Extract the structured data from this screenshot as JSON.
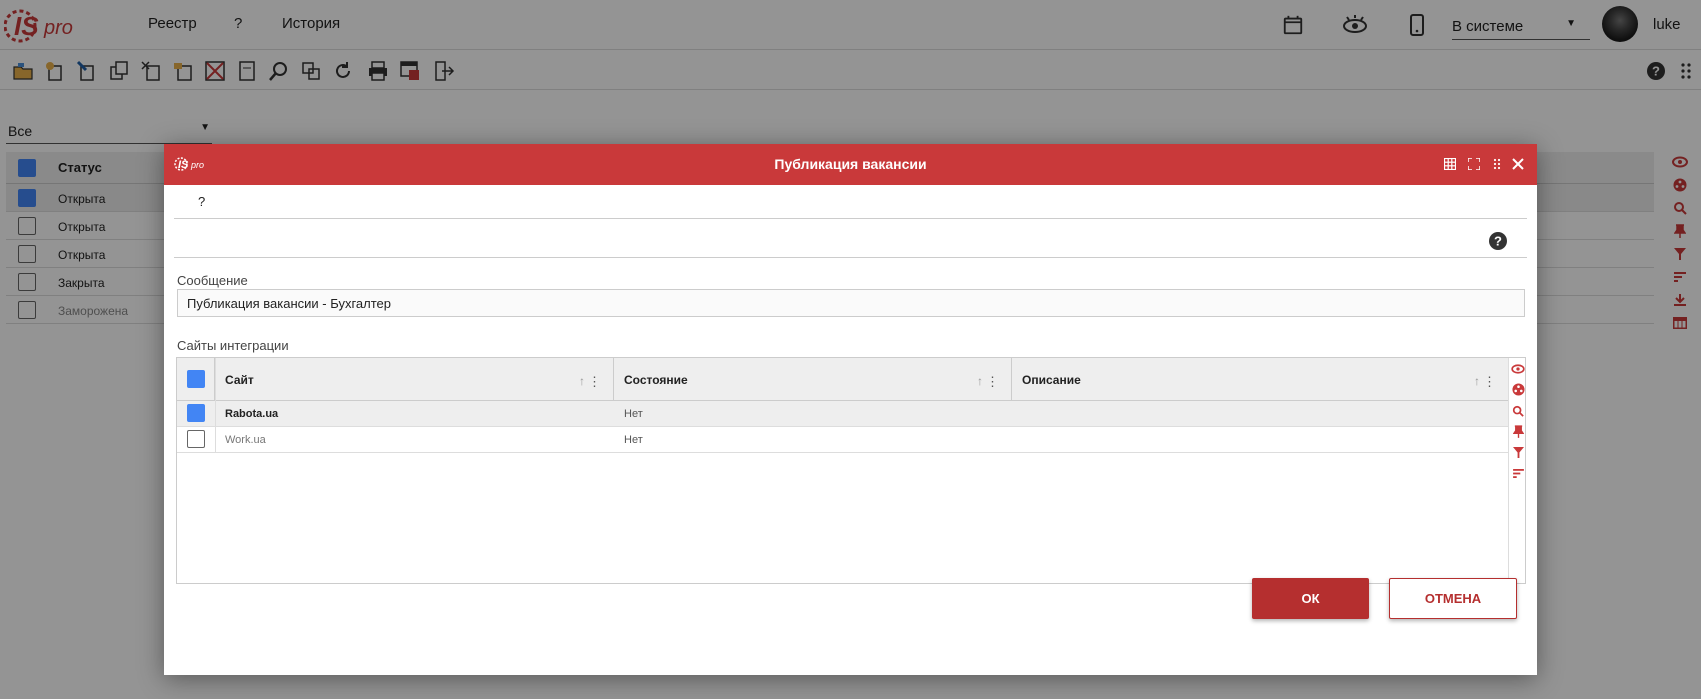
{
  "app": {
    "logo_text": "ISpro"
  },
  "topbar": {
    "menu": [
      "Реестр",
      "?",
      "История"
    ],
    "status_select": "В системе",
    "user": "luke"
  },
  "main": {
    "filter_value": "Все",
    "column_header": "Статус",
    "rows": [
      {
        "status": "Открыта",
        "checked": true
      },
      {
        "status": "Открыта",
        "checked": false
      },
      {
        "status": "Открыта",
        "checked": false
      },
      {
        "status": "Закрыта",
        "checked": false
      },
      {
        "status": "Заморожена",
        "checked": false
      }
    ]
  },
  "dialog": {
    "title": "Публикация вакансии",
    "menu_item": "?",
    "message_label": "Сообщение",
    "message_value": "Публикация вакансии - Бухгалтер",
    "integration_label": "Сайты интеграции",
    "columns": [
      "Сайт",
      "Состояние",
      "Описание"
    ],
    "rows": [
      {
        "site": "Rabota.ua",
        "state": "Нет",
        "checked": true
      },
      {
        "site": "Work.ua",
        "state": "Нет",
        "checked": false
      }
    ],
    "ok_label": "ОК",
    "cancel_label": "ОТМЕНА"
  },
  "colors": {
    "accent": "#c9393a",
    "checkbox": "#4285f4",
    "button": "#b52f2f"
  }
}
